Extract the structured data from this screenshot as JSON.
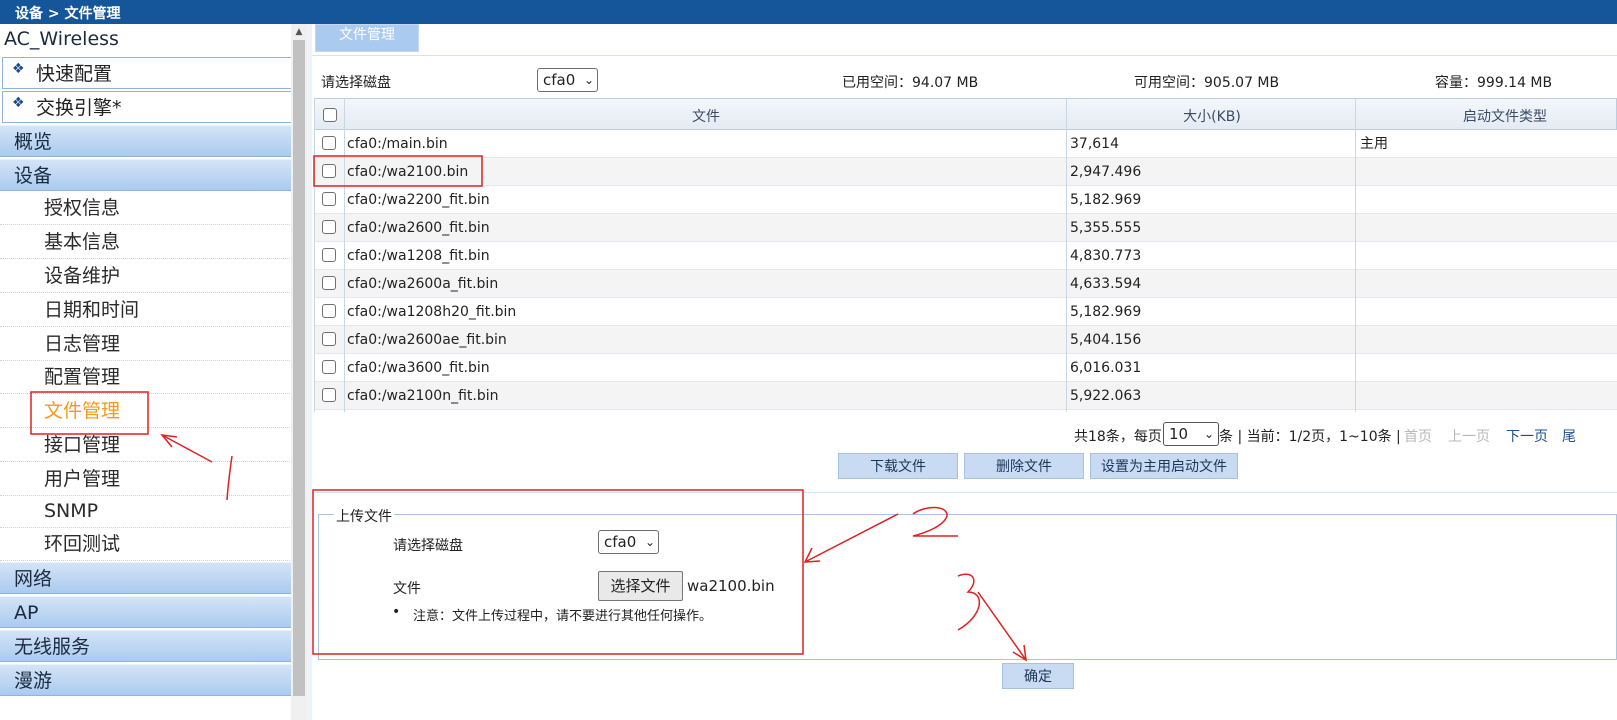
{
  "breadcrumb": "设备 > 文件管理",
  "sidebar": {
    "app_title": "AC_Wireless",
    "quick": [
      {
        "label": "快速配置"
      },
      {
        "label": "交换引擎*"
      }
    ],
    "categories": {
      "overview": "概览",
      "device": "设备",
      "network": "网络",
      "ap": "AP",
      "wireless": "无线服务",
      "roaming": "漫游"
    },
    "device_items": [
      {
        "label": "授权信息"
      },
      {
        "label": "基本信息"
      },
      {
        "label": "设备维护"
      },
      {
        "label": "日期和时间"
      },
      {
        "label": "日志管理"
      },
      {
        "label": "配置管理"
      },
      {
        "label": "文件管理"
      },
      {
        "label": "接口管理"
      },
      {
        "label": "用户管理"
      },
      {
        "label": "SNMP"
      },
      {
        "label": "环回测试"
      }
    ]
  },
  "main": {
    "tab": "文件管理",
    "disk_label": "请选择磁盘",
    "disk_value": "cfa0",
    "used_space": "已用空间：94.07 MB",
    "free_space": "可用空间：905.07 MB",
    "capacity": "容量：999.14 MB",
    "columns": {
      "file": "文件",
      "size": "大小(KB)",
      "boot_type": "启动文件类型"
    },
    "rows": [
      {
        "file": "cfa0:/main.bin",
        "size": "37,614",
        "type": "主用"
      },
      {
        "file": "cfa0:/wa2100.bin",
        "size": "2,947.496",
        "type": ""
      },
      {
        "file": "cfa0:/wa2200_fit.bin",
        "size": "5,182.969",
        "type": ""
      },
      {
        "file": "cfa0:/wa2600_fit.bin",
        "size": "5,355.555",
        "type": ""
      },
      {
        "file": "cfa0:/wa1208_fit.bin",
        "size": "4,830.773",
        "type": ""
      },
      {
        "file": "cfa0:/wa2600a_fit.bin",
        "size": "4,633.594",
        "type": ""
      },
      {
        "file": "cfa0:/wa1208h20_fit.bin",
        "size": "5,182.969",
        "type": ""
      },
      {
        "file": "cfa0:/wa2600ae_fit.bin",
        "size": "5,404.156",
        "type": ""
      },
      {
        "file": "cfa0:/wa3600_fit.bin",
        "size": "6,016.031",
        "type": ""
      },
      {
        "file": "cfa0:/wa2100n_fit.bin",
        "size": "5,922.063",
        "type": ""
      }
    ],
    "pager": {
      "total_prefix": "共18条，每页",
      "page_size": "10",
      "info": "条 | 当前：1/2页，1~10条 |",
      "first": "首页",
      "prev": "上一页",
      "next": "下一页",
      "last": "尾"
    },
    "buttons": {
      "download": "下载文件",
      "delete": "删除文件",
      "set_main": "设置为主用启动文件"
    },
    "upload": {
      "legend": "上传文件",
      "disk_label": "请选择磁盘",
      "disk_value": "cfa0",
      "file_label": "文件",
      "choose_button": "选择文件",
      "chosen_file": "wa2100.bin",
      "note": "注意：文件上传过程中，请不要进行其他任何操作。"
    },
    "confirm": "确定"
  },
  "annotations": {
    "step1": "1",
    "step2": "2",
    "step3": "3",
    "color": "#e02020"
  }
}
